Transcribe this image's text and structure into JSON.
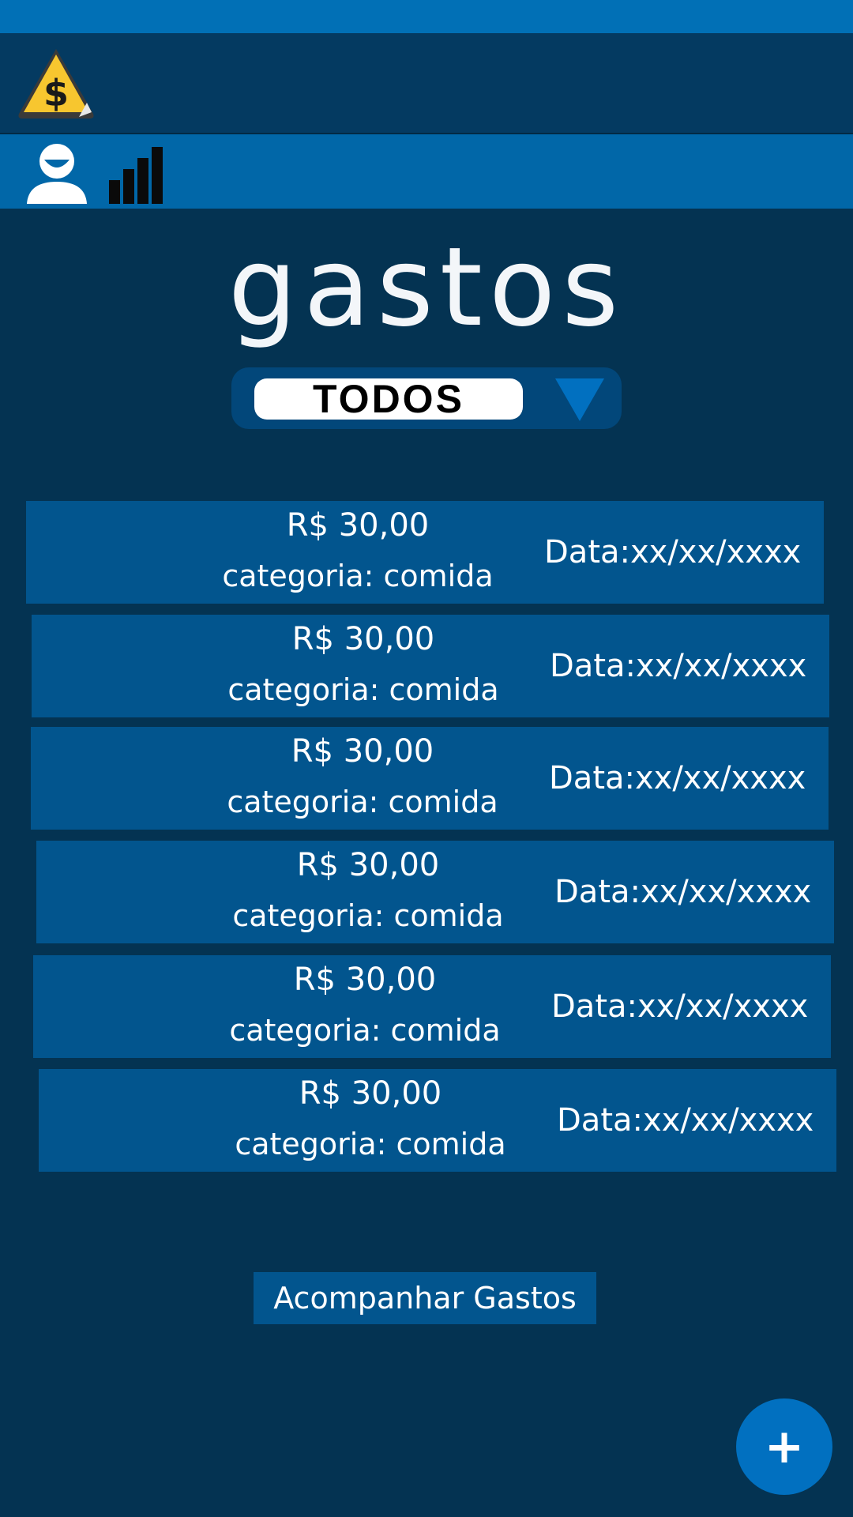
{
  "header": {
    "logo_icon": "dollar-warning-icon",
    "logo_symbol": "$"
  },
  "nav": {
    "user_icon": "user-icon",
    "chart_icon": "bar-chart-icon"
  },
  "page": {
    "title": "gastos"
  },
  "filter": {
    "selected": "TODOS",
    "arrow_icon": "triangle-down-icon"
  },
  "expenses": [
    {
      "value": "R$ 30,00",
      "category": "categoria: comida",
      "date": "Data:xx/xx/xxxx"
    },
    {
      "value": "R$ 30,00",
      "category": "categoria: comida",
      "date": "Data:xx/xx/xxxx"
    },
    {
      "value": "R$ 30,00",
      "category": "categoria: comida",
      "date": "Data:xx/xx/xxxx"
    },
    {
      "value": "R$ 30,00",
      "category": "categoria: comida",
      "date": "Data:xx/xx/xxxx"
    },
    {
      "value": "R$ 30,00",
      "category": "categoria: comida",
      "date": "Data:xx/xx/xxxx"
    },
    {
      "value": "R$ 30,00",
      "category": "categoria: comida",
      "date": "Data:xx/xx/xxxx"
    }
  ],
  "actions": {
    "track_label": "Acompanhar Gastos",
    "add_label": "+"
  },
  "colors": {
    "background": "#043352",
    "status_bar": "#0170b6",
    "nav_bar": "#0167a8",
    "row": "#02558e",
    "accent": "#0170c0"
  }
}
